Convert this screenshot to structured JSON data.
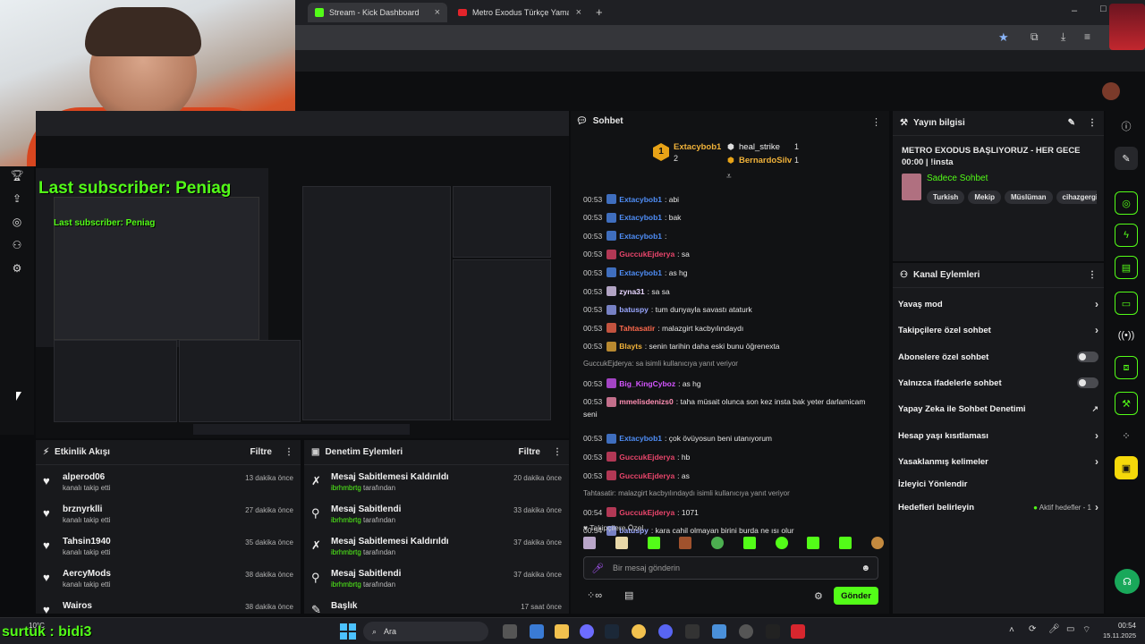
{
  "browser": {
    "tabs": [
      {
        "label": "Stream - Kick Dashboard",
        "active": true
      },
      {
        "label": "Metro Exodus Türkçe Yama - Yo",
        "active": false
      }
    ],
    "new_tab": "+"
  },
  "overlay": {
    "last_subscriber": "Last subscriber: Peniag",
    "last_subscriber_small": "Last subscriber: Peniag",
    "bottom_left": "surtuk : bidi3"
  },
  "activity": {
    "title": "Etkinlik Akışı",
    "filter": "Filtre",
    "items": [
      {
        "name": "alperod06",
        "sub": "kanalı takip etti",
        "time": "13 dakika önce"
      },
      {
        "name": "brznyrklli",
        "sub": "kanalı takip etti",
        "time": "27 dakika önce"
      },
      {
        "name": "Tahsin1940",
        "sub": "kanalı takip etti",
        "time": "35 dakika önce"
      },
      {
        "name": "AercyMods",
        "sub": "kanalı takip etti",
        "time": "38 dakika önce"
      },
      {
        "name": "Wairos",
        "sub": "",
        "time": "38 dakika önce"
      }
    ]
  },
  "moderation": {
    "title": "Denetim Eylemleri",
    "filter": "Filtre",
    "items": [
      {
        "name": "Mesaj Sabitlemesi Kaldırıldı",
        "user": "ibrhmbrtg",
        "sub": "tarafından",
        "time": "20 dakika önce",
        "icon": "unpin"
      },
      {
        "name": "Mesaj Sabitlendi",
        "user": "ibrhmbrtg",
        "sub": "tarafından",
        "time": "33 dakika önce",
        "icon": "pin"
      },
      {
        "name": "Mesaj Sabitlemesi Kaldırıldı",
        "user": "ibrhmbrtg",
        "sub": "tarafından",
        "time": "37 dakika önce",
        "icon": "unpin"
      },
      {
        "name": "Mesaj Sabitlendi",
        "user": "ibrhmbrtg",
        "sub": "tarafından",
        "time": "37 dakika önce",
        "icon": "pin"
      },
      {
        "name": "Başlık",
        "user": "",
        "sub": "",
        "time": "17 saat önce",
        "icon": "edit"
      }
    ]
  },
  "chat": {
    "title": "Sohbet",
    "leaders": [
      {
        "rank": "1",
        "name": "Extacybob1",
        "count": "2"
      },
      {
        "name": "heal_strike",
        "count": "1"
      },
      {
        "name": "BernardoSilv",
        "count": "1"
      }
    ],
    "messages": [
      {
        "time": "00:53",
        "user": "Extacybob1",
        "color": "#4f8ef7",
        "text": ": abi"
      },
      {
        "time": "00:53",
        "user": "Extacybob1",
        "color": "#4f8ef7",
        "text": ": bak"
      },
      {
        "time": "00:53",
        "user": "Extacybob1",
        "color": "#4f8ef7",
        "text": ":"
      },
      {
        "time": "00:53",
        "user": "GuccukEjderya",
        "color": "#e8456b",
        "text": ": sa"
      },
      {
        "time": "00:53",
        "user": "Extacybob1",
        "color": "#4f8ef7",
        "text": ": as hg"
      },
      {
        "time": "00:53",
        "user": "zyna31",
        "color": "#e8d6ff",
        "text": ": sa sa"
      },
      {
        "time": "00:53",
        "user": "batuspy",
        "color": "#9aa7ff",
        "text": ": tum dunyayla savastı ataturk"
      },
      {
        "time": "00:53",
        "user": "Tahtasatir",
        "color": "#ff6a4d",
        "text": ": malazgirt kacbyılındaydı"
      },
      {
        "time": "00:53",
        "user": "Blayts",
        "color": "#f0b23a",
        "text": ": senin tarihin daha eski bunu öğrenexta"
      },
      {
        "reply": "GuccukEjderya: sa isimli kullanıcıya yanıt veriyor"
      },
      {
        "time": "00:53",
        "user": "Big_KingCyboz",
        "color": "#d455ff",
        "text": ": as hg"
      },
      {
        "time": "00:53",
        "user": "mmelisdenizs0",
        "color": "#ff8fb3",
        "text": ": taha müsait olunca son kez insta bak yeter darlamicam"
      },
      {
        "cont": "seni"
      },
      {
        "time": "00:53",
        "user": "Extacybob1",
        "color": "#4f8ef7",
        "text": ": çok övüyosun beni utanıyorum"
      },
      {
        "time": "00:53",
        "user": "GuccukEjderya",
        "color": "#e8456b",
        "text": ": hb"
      },
      {
        "time": "00:53",
        "user": "GuccukEjderya",
        "color": "#e8456b",
        "text": ": as"
      },
      {
        "reply": "Tahtasatir: malazgirt kacbyılındaydı isimli kullanıcıya yanıt veriyor"
      },
      {
        "time": "00:54",
        "user": "GuccukEjderya",
        "color": "#e8456b",
        "text": ": 1071"
      },
      {
        "time": "00:54",
        "user": "batuspy",
        "color": "#9aa7ff",
        "text": ": kara cahil olmayan birini burda ne ısı olur"
      }
    ],
    "followers_only": "Takipçilere Özel",
    "input_placeholder": "Bir mesaj gönderin",
    "send": "Gönder"
  },
  "stream_info": {
    "title": "Yayın bilgisi",
    "stream_title": "METRO EXODUS BAŞLIYORUZ - HER GECE 00:00 | !insta",
    "category": "Sadece Sohbet",
    "tags": [
      "Turkish",
      "Mekip",
      "Müslüman",
      "cihazgergin"
    ]
  },
  "channel_actions": {
    "title": "Kanal Eylemleri",
    "items": [
      {
        "label": "Yavaş mod",
        "kind": "chevron"
      },
      {
        "label": "Takipçilere özel sohbet",
        "kind": "chevron"
      },
      {
        "label": "Abonelere özel sohbet",
        "kind": "toggle"
      },
      {
        "label": "Yalnızca ifadelerle sohbet",
        "kind": "toggle"
      },
      {
        "label": "Yapay Zeka ile Sohbet Denetimi",
        "kind": "external"
      },
      {
        "label": "Hesap yaşı kısıtlaması",
        "kind": "chevron"
      },
      {
        "label": "Yasaklanmış kelimeler",
        "kind": "chevron"
      },
      {
        "label": "İzleyici Yönlendir",
        "kind": "none"
      },
      {
        "label": "Hedefleri belirleyin",
        "kind": "goal"
      }
    ],
    "goal_status": "Aktif hedefler - 1"
  },
  "taskbar": {
    "search": "Ara",
    "weather": "10°C",
    "time": "00:54",
    "date": "15.11.2025"
  },
  "colors": {
    "accent": "#53fc18",
    "bg": "#0b0c0e",
    "panel": "#18191c"
  }
}
